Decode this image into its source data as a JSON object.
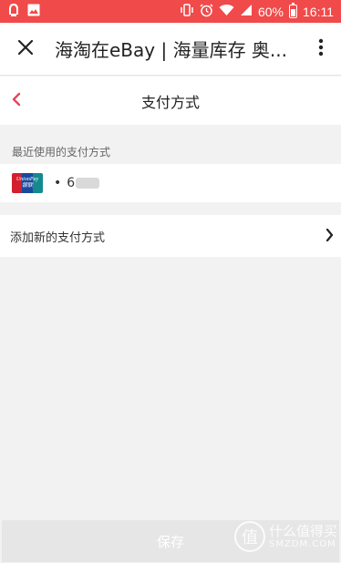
{
  "status_bar": {
    "battery_percent": "60%",
    "time": "16:11",
    "icons": [
      "app-notification-icon",
      "image-icon",
      "vibrate-icon",
      "alarm-icon",
      "wifi-icon",
      "signal-icon",
      "battery-icon"
    ]
  },
  "app_bar": {
    "title": "海淘在eBay | 海量库存 奥...",
    "close_icon": "close-icon",
    "more_icon": "more-vert-icon"
  },
  "page": {
    "title": "支付方式",
    "back_icon": "chevron-left-icon"
  },
  "recent_section": {
    "label": "最近使用的支付方式",
    "card": {
      "brand_line1": "UnionPay",
      "brand_line2": "银联",
      "bullet": "•",
      "number_visible": "6"
    }
  },
  "add_method": {
    "label": "添加新的支付方式",
    "chevron_icon": "chevron-right-icon"
  },
  "footer": {
    "save_label": "保存"
  },
  "watermark": {
    "logo_char": "值",
    "line1": "什么值得买",
    "line2": "SMZDM.COM"
  },
  "colors": {
    "status_bar": "#f04a4a",
    "accent": "#e8455a",
    "background": "#f2f2f2",
    "save_button": "#e6e6e6"
  }
}
